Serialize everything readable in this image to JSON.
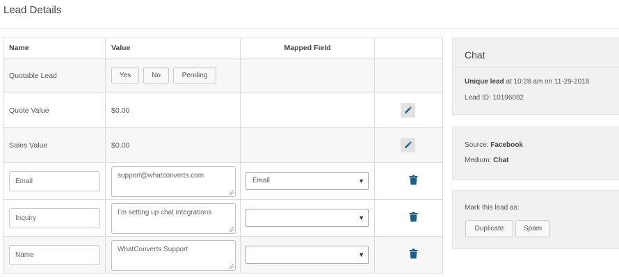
{
  "page": {
    "title": "Lead Details"
  },
  "table": {
    "headers": {
      "name": "Name",
      "value": "Value",
      "mapped": "Mapped Field"
    },
    "quotable": {
      "label": "Quotable Lead",
      "buttons": {
        "yes": "Yes",
        "no": "No",
        "pending": "Pending"
      }
    },
    "quote_value": {
      "label": "Quote Value",
      "value": "$0.00"
    },
    "sales_value": {
      "label": "Sales Value",
      "value": "$0.00"
    },
    "rows": [
      {
        "name": "Email",
        "value": "support@whatconverts.com",
        "mapped": "Email"
      },
      {
        "name": "Inquiry",
        "value": "I'm setting up chat integrations",
        "mapped": ""
      },
      {
        "name": "Name",
        "value": "WhatConverts Support",
        "mapped": ""
      }
    ],
    "icons": {
      "edit": "pencil-icon",
      "delete": "trash-icon",
      "dropdown": "caret-down-icon"
    }
  },
  "chat_panel": {
    "title": "Chat",
    "unique_label": "Unique lead",
    "unique_rest": " at 10:28 am on 11-29-2018",
    "lead_id": "Lead ID: 10196082"
  },
  "source_panel": {
    "source_label": "Source: ",
    "source_value": "Facebook",
    "medium_label": "Medium: ",
    "medium_value": "Chat"
  },
  "mark_panel": {
    "label": "Mark this lead as:",
    "duplicate": "Duplicate",
    "spam": "Spam"
  },
  "colors": {
    "icon": "#1f5f86",
    "panel_bg": "#f1f1f1"
  }
}
